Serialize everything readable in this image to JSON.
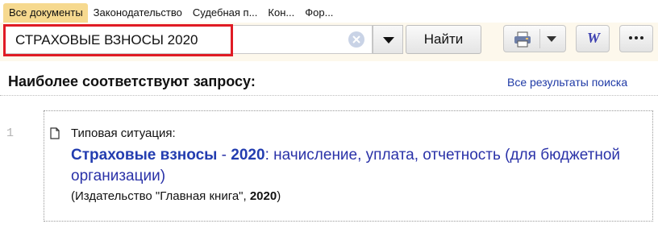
{
  "tabs": [
    {
      "label": "Все документы",
      "active": true
    },
    {
      "label": "Законодательство",
      "active": false
    },
    {
      "label": "Судебная п...",
      "active": false
    },
    {
      "label": "Кон...",
      "active": false
    },
    {
      "label": "Фор...",
      "active": false
    }
  ],
  "search": {
    "value": "СТРАХОВЫЕ ВЗНОСЫ 2020",
    "find_label": "Найти",
    "highlight_color": "#e01b24"
  },
  "toolbar": {
    "icons": [
      "print-icon",
      "dropdown-arrow-icon",
      "word-export-icon",
      "more-icon"
    ],
    "word_glyph": "W"
  },
  "results": {
    "heading": "Наиболее соответствуют запросу:",
    "all_results_label": "Все результаты поиска",
    "items": [
      {
        "number": "1",
        "type_label": "Типовая ситуация:",
        "title_match1": "Страховые взносы",
        "title_sep": " - ",
        "title_match2": "2020",
        "title_rest": ": начисление, уплата, отчетность (для бюджетной организации)",
        "source_prefix": "(Издательство \"Главная книга\", ",
        "source_year": "2020",
        "source_suffix": ")"
      }
    ]
  },
  "colors": {
    "tab_active_bg": "#f6d98f",
    "link": "#1f3aa6",
    "title": "#2a32a8"
  }
}
